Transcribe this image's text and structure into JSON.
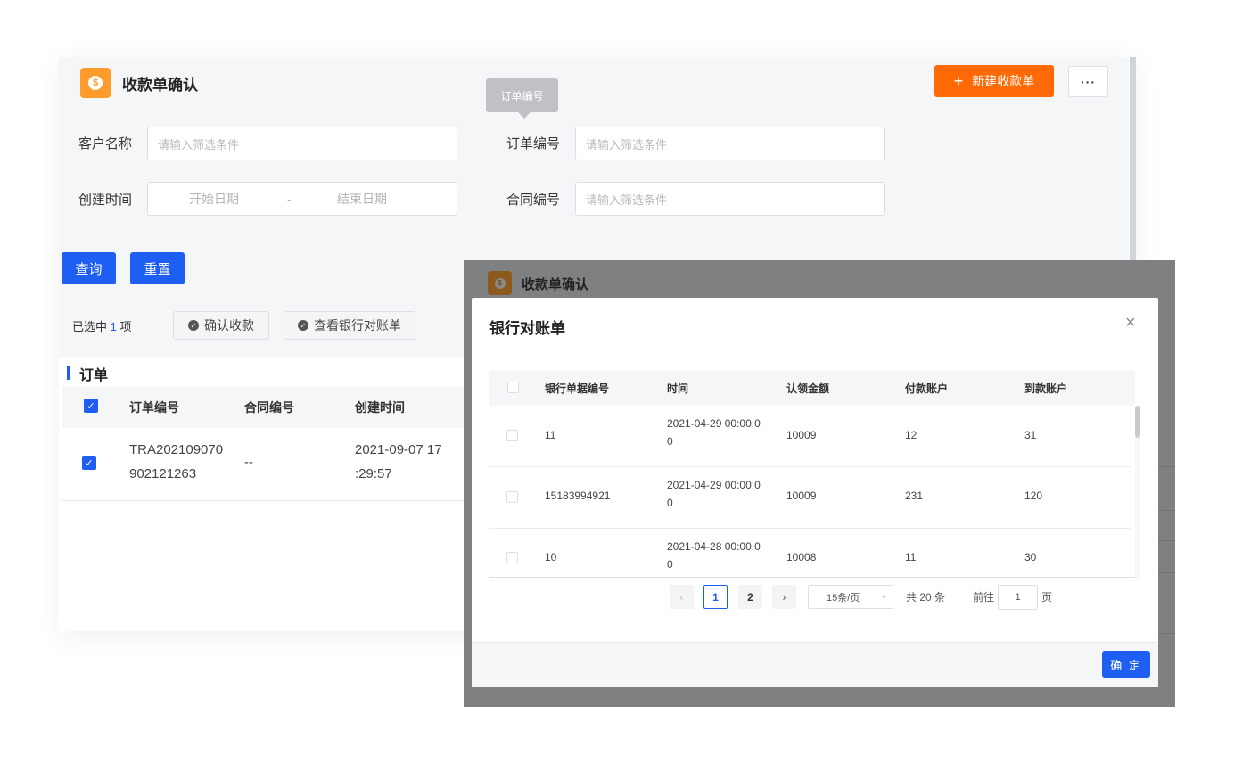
{
  "page": {
    "title": "收款单确认",
    "new_button": "新建收款单",
    "more_button": "···"
  },
  "tooltip": "订单编号",
  "filters": {
    "customer_label": "客户名称",
    "customer_placeholder": "请输入筛选条件",
    "order_label": "订单编号",
    "order_placeholder": "请输入筛选条件",
    "created_label": "创建时间",
    "start_date": "开始日期",
    "date_sep": "-",
    "end_date": "结束日期",
    "contract_label": "合同编号",
    "contract_placeholder": "请输入筛选条件"
  },
  "actions": {
    "query": "查询",
    "reset": "重置"
  },
  "selection": {
    "prefix": "已选中",
    "count": "1",
    "suffix": "项",
    "confirm_button": "确认收款",
    "view_button": "查看银行对账单"
  },
  "orders": {
    "section_title": "订单",
    "columns": [
      "订单编号",
      "合同编号",
      "创建时间"
    ],
    "rows": [
      {
        "order_line1": "TRA202109070",
        "order_line2": "902121263",
        "contract": "--",
        "time_line1": "2021-09-07 17",
        "time_line2": ":29:57"
      }
    ]
  },
  "overlay": {
    "title": "收款单确认"
  },
  "modal": {
    "title": "银行对账单",
    "close": "×",
    "columns": [
      "银行单据编号",
      "时间",
      "认领金额",
      "付款账户",
      "到款账户"
    ],
    "rows": [
      {
        "id": "11",
        "time_line1": "2021-04-29 00:00:0",
        "time_line2": "0",
        "amount": "10009",
        "payer": "12",
        "payee": "31"
      },
      {
        "id": "15183994921",
        "time_line1": "2021-04-29 00:00:0",
        "time_line2": "0",
        "amount": "10009",
        "payer": "231",
        "payee": "120"
      },
      {
        "id": "10",
        "time_line1": "2021-04-28 00:00:0",
        "time_line2": "0",
        "amount": "10008",
        "payer": "11",
        "payee": "30"
      }
    ],
    "pagination": {
      "prev": "‹",
      "pages": [
        "1",
        "2"
      ],
      "next": "›",
      "page_size": "15条/页",
      "total": "共 20 条",
      "goto_label": "前往",
      "goto_value": "1",
      "goto_suffix": "页"
    },
    "ok_button": "确 定"
  },
  "colors": {
    "primary": "#1f5ef2",
    "accent": "#ff6a06",
    "logo": "#ff9b2b"
  }
}
